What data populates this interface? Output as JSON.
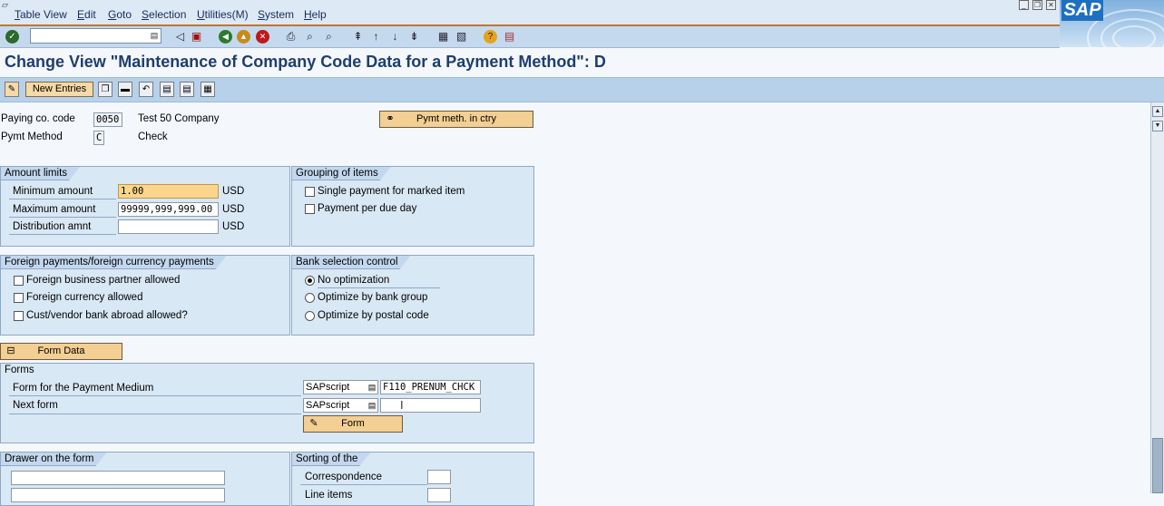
{
  "menu": {
    "items": [
      "Table View",
      "Edit",
      "Goto",
      "Selection",
      "Utilities(M)",
      "System",
      "Help"
    ]
  },
  "logo": {
    "text": "SAP"
  },
  "toolbar": {
    "command_value": ""
  },
  "page": {
    "title": "Change View \"Maintenance of Company Code Data for a Payment Method\": D"
  },
  "app_toolbar": {
    "new_entries": "New Entries"
  },
  "header": {
    "paying_code_label": "Paying co. code",
    "paying_code_value": "0050",
    "company_name": "Test 50 Company",
    "pymt_method_label": "Pymt Method",
    "pymt_method_value": "C",
    "pymt_method_desc": "Check",
    "pymt_meth_btn": "Pymt meth. in ctry"
  },
  "amount_limits": {
    "title": "Amount limits",
    "min_label": "Minimum amount",
    "min_value": "1.00",
    "min_cur": "USD",
    "max_label": "Maximum amount",
    "max_value": "99999,999,999.00",
    "max_cur": "USD",
    "dist_label": "Distribution amnt",
    "dist_value": "",
    "dist_cur": "USD"
  },
  "grouping": {
    "title": "Grouping of items",
    "single": "Single payment for marked item",
    "per_due": "Payment per due day"
  },
  "foreign": {
    "title": "Foreign payments/foreign currency payments",
    "partner": "Foreign business partner allowed",
    "currency": "Foreign currency allowed",
    "abroad": "Cust/vendor bank abroad allowed?"
  },
  "bank_sel": {
    "title": "Bank selection control",
    "none": "No optimization",
    "group": "Optimize by bank group",
    "postal": "Optimize by postal code"
  },
  "form_data_btn": "Form Data",
  "forms": {
    "title": "Forms",
    "medium_label": "Form for the Payment Medium",
    "medium_type": "SAPscript",
    "medium_value": "F110_PRENUM_CHCK",
    "next_label": "Next form",
    "next_type": "SAPscript",
    "next_value": "",
    "form_btn": "Form"
  },
  "drawer": {
    "title": "Drawer on the form"
  },
  "sorting": {
    "title": "Sorting of the",
    "correspondence": "Correspondence",
    "line_items": "Line items"
  }
}
